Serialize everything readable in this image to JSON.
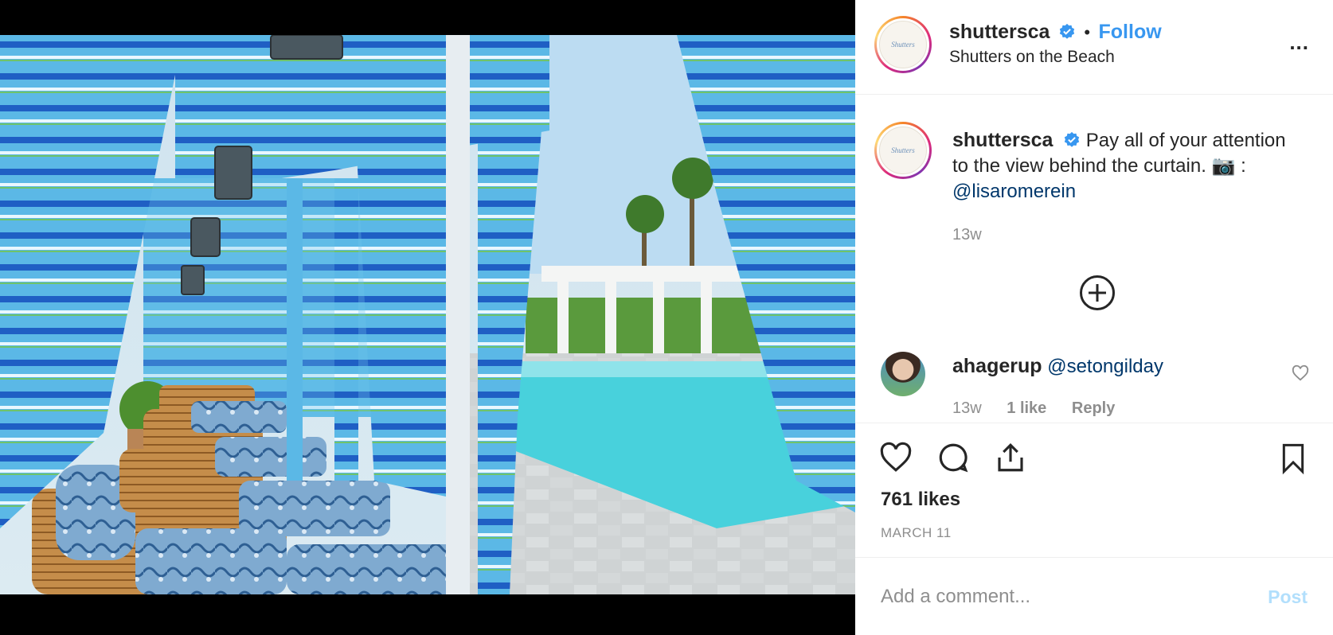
{
  "post": {
    "username": "shuttersca",
    "follow_label": "Follow",
    "separator": "•",
    "location": "Shutters on the Beach",
    "avatar_text": "Shutters",
    "more_label": "..."
  },
  "caption": {
    "username": "shuttersca",
    "text": "Pay all of your attention to the view behind the curtain. 📷 : ",
    "mention": "@lisaromerein",
    "time": "13w"
  },
  "comment": {
    "username": "ahagerup",
    "mention": "@setongilday",
    "time": "13w",
    "likes": "1 like",
    "reply_label": "Reply"
  },
  "stats": {
    "likes": "761 likes",
    "date": "MARCH 11"
  },
  "add_comment": {
    "placeholder": "Add a comment...",
    "post_label": "Post"
  },
  "colors": {
    "accent": "#3897f0",
    "mention": "#00376b",
    "muted": "#8e8e8e",
    "post_disabled": "#b2dffc"
  },
  "icons": [
    "verified-badge-icon",
    "more-icon",
    "plus-circle-icon",
    "heart-icon",
    "comment-icon",
    "share-icon",
    "bookmark-icon"
  ]
}
